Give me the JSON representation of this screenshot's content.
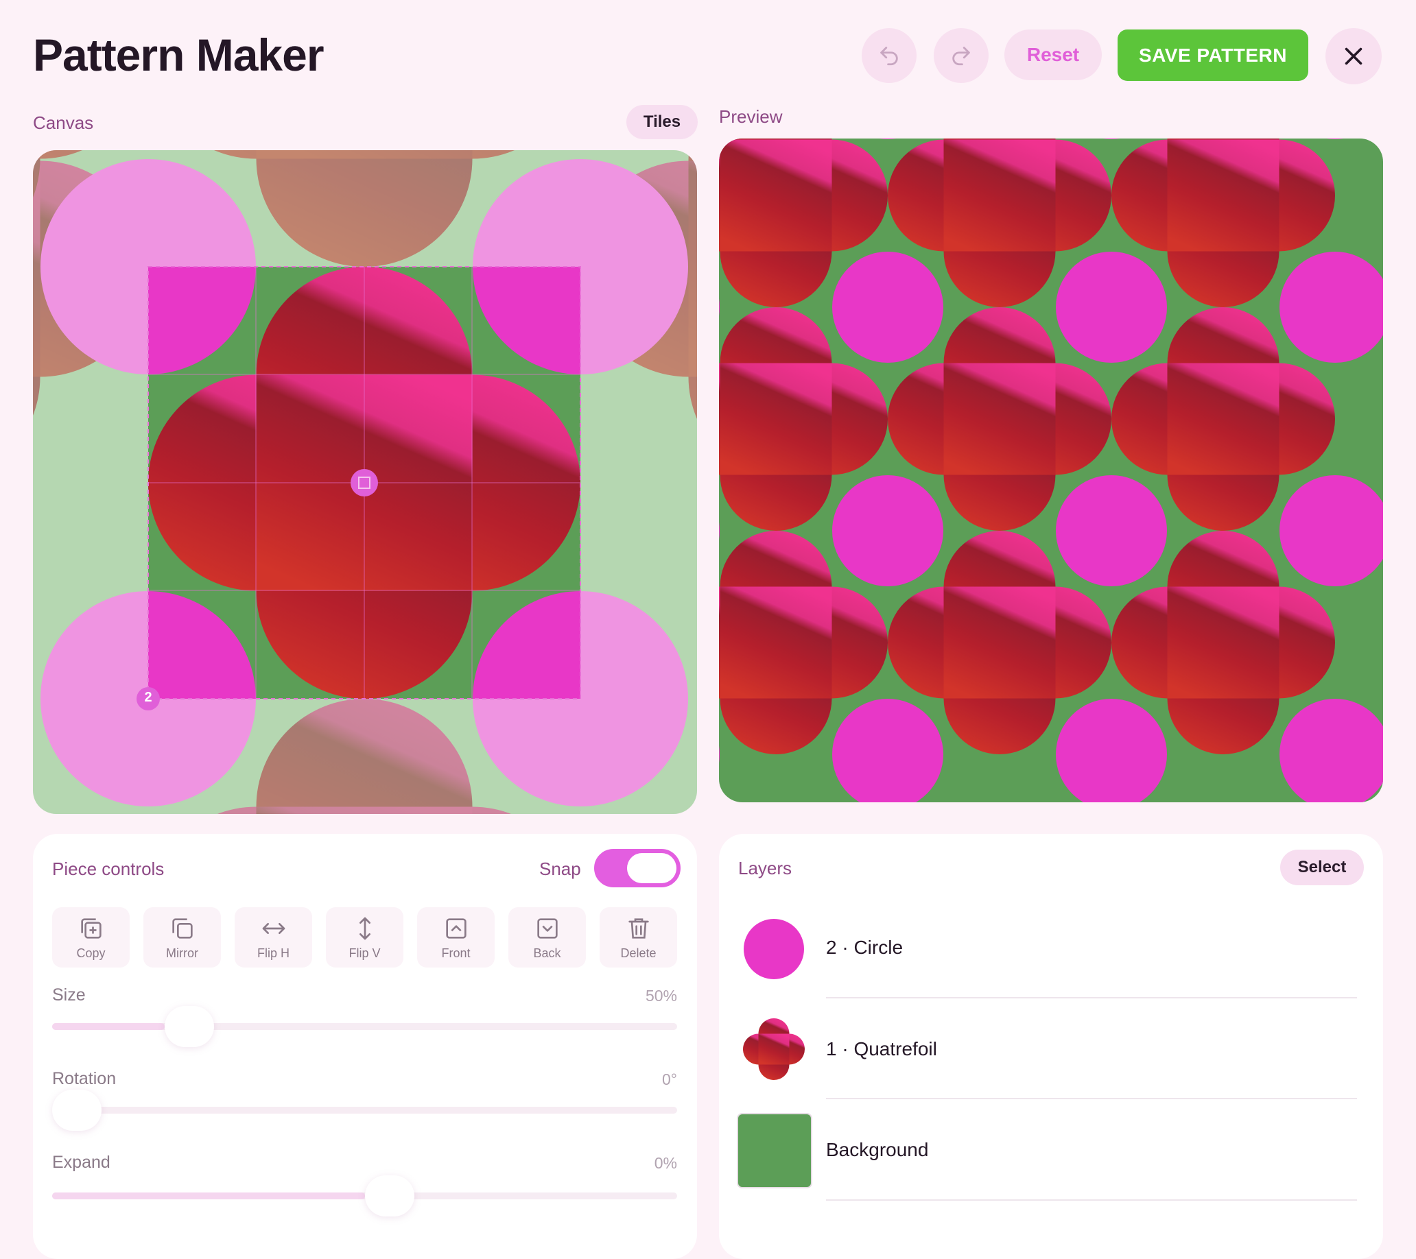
{
  "app": {
    "title": "Pattern Maker"
  },
  "header": {
    "undo_icon": "undo-icon",
    "redo_icon": "redo-icon",
    "reset_label": "Reset",
    "save_label": "SAVE PATTERN",
    "close_icon": "close-icon"
  },
  "canvas": {
    "label": "Canvas",
    "tiles_label": "Tiles",
    "selection_badge": "2"
  },
  "preview": {
    "label": "Preview"
  },
  "colors": {
    "background": "#5c9e57",
    "circle": "#e837c7",
    "quatrefoil_dark": "#9a1d2e",
    "quatrefoil_red": "#d2342a",
    "quatrefoil_pink": "#f0328f",
    "save_green": "#5cc53a",
    "accent": "#e05fd8"
  },
  "piece_controls": {
    "title": "Piece controls",
    "snap_label": "Snap",
    "snap_on": true,
    "tools": [
      {
        "label": "Copy",
        "icon": "copy-icon"
      },
      {
        "label": "Mirror",
        "icon": "mirror-icon"
      },
      {
        "label": "Flip H",
        "icon": "flip-h-icon"
      },
      {
        "label": "Flip V",
        "icon": "flip-v-icon"
      },
      {
        "label": "Front",
        "icon": "bring-front-icon"
      },
      {
        "label": "Back",
        "icon": "send-back-icon"
      },
      {
        "label": "Delete",
        "icon": "trash-icon"
      }
    ],
    "sliders": [
      {
        "label": "Size",
        "value": "50%",
        "level": 0.18
      },
      {
        "label": "Rotation",
        "value": "0°",
        "level": 0.0
      },
      {
        "label": "Expand",
        "value": "0%",
        "level": 0.5
      }
    ]
  },
  "layers": {
    "title": "Layers",
    "select_label": "Select",
    "items": [
      {
        "label": "2 · Circle",
        "shape": "circle"
      },
      {
        "label": "1 · Quatrefoil",
        "shape": "quatrefoil"
      },
      {
        "label": "Background",
        "shape": "square"
      }
    ]
  }
}
